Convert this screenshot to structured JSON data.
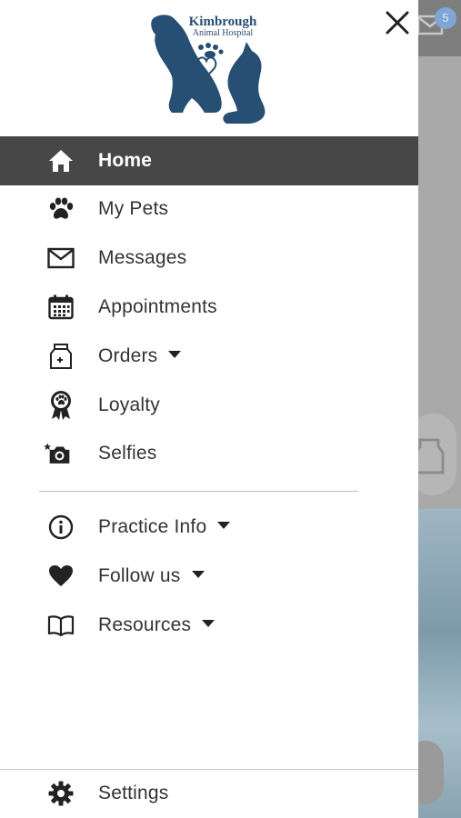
{
  "brand": {
    "name_line1": "Kimbrough",
    "name_line2": "Animal Hospital",
    "color": "#264f73"
  },
  "background_app": {
    "badge_count": "5"
  },
  "menu": {
    "items": [
      {
        "label": "Home",
        "icon": "home-icon",
        "active": true
      },
      {
        "label": "My Pets",
        "icon": "paw-icon"
      },
      {
        "label": "Messages",
        "icon": "envelope-icon"
      },
      {
        "label": "Appointments",
        "icon": "calendar-icon"
      },
      {
        "label": "Orders",
        "icon": "medicine-jar-icon",
        "expandable": true
      },
      {
        "label": "Loyalty",
        "icon": "award-ribbon-icon"
      },
      {
        "label": "Selfies",
        "icon": "camera-icon"
      }
    ],
    "secondary": [
      {
        "label": "Practice Info",
        "icon": "info-icon",
        "expandable": true
      },
      {
        "label": "Follow us",
        "icon": "heart-icon",
        "expandable": true
      },
      {
        "label": "Resources",
        "icon": "book-icon",
        "expandable": true
      }
    ],
    "footer": {
      "label": "Settings",
      "icon": "gear-icon"
    }
  },
  "colors": {
    "active_bg": "#474747",
    "text": "#333333",
    "divider": "#bdbdbd"
  }
}
